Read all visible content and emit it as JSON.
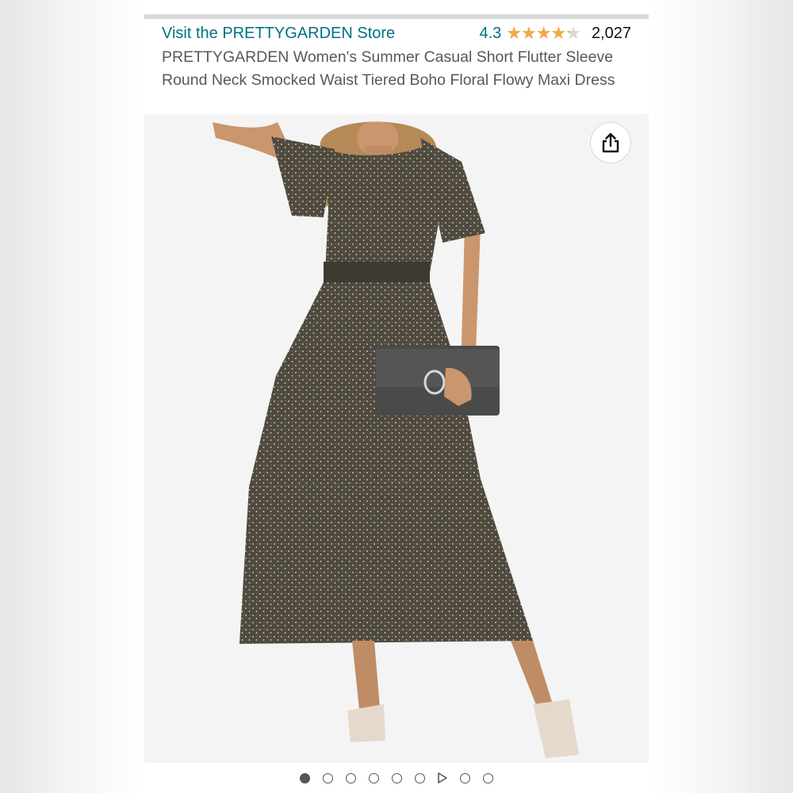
{
  "header": {
    "store_link": "Visit the PRETTYGARDEN Store",
    "rating_value": "4.3",
    "rating_stars": 4.3,
    "review_count": "2,027",
    "title": "PRETTYGARDEN Women's Summer Casual Short Flutter Sleeve Round Neck Smocked Waist Tiered Boho Floral Flowy Maxi Dress"
  },
  "gallery": {
    "share_icon": "share-icon",
    "current_index": 1,
    "indicators": [
      "image",
      "image",
      "image",
      "image",
      "image",
      "image",
      "video",
      "image",
      "image"
    ]
  },
  "colors": {
    "link": "#007185",
    "star": "#f3a847",
    "text": "#565959"
  }
}
